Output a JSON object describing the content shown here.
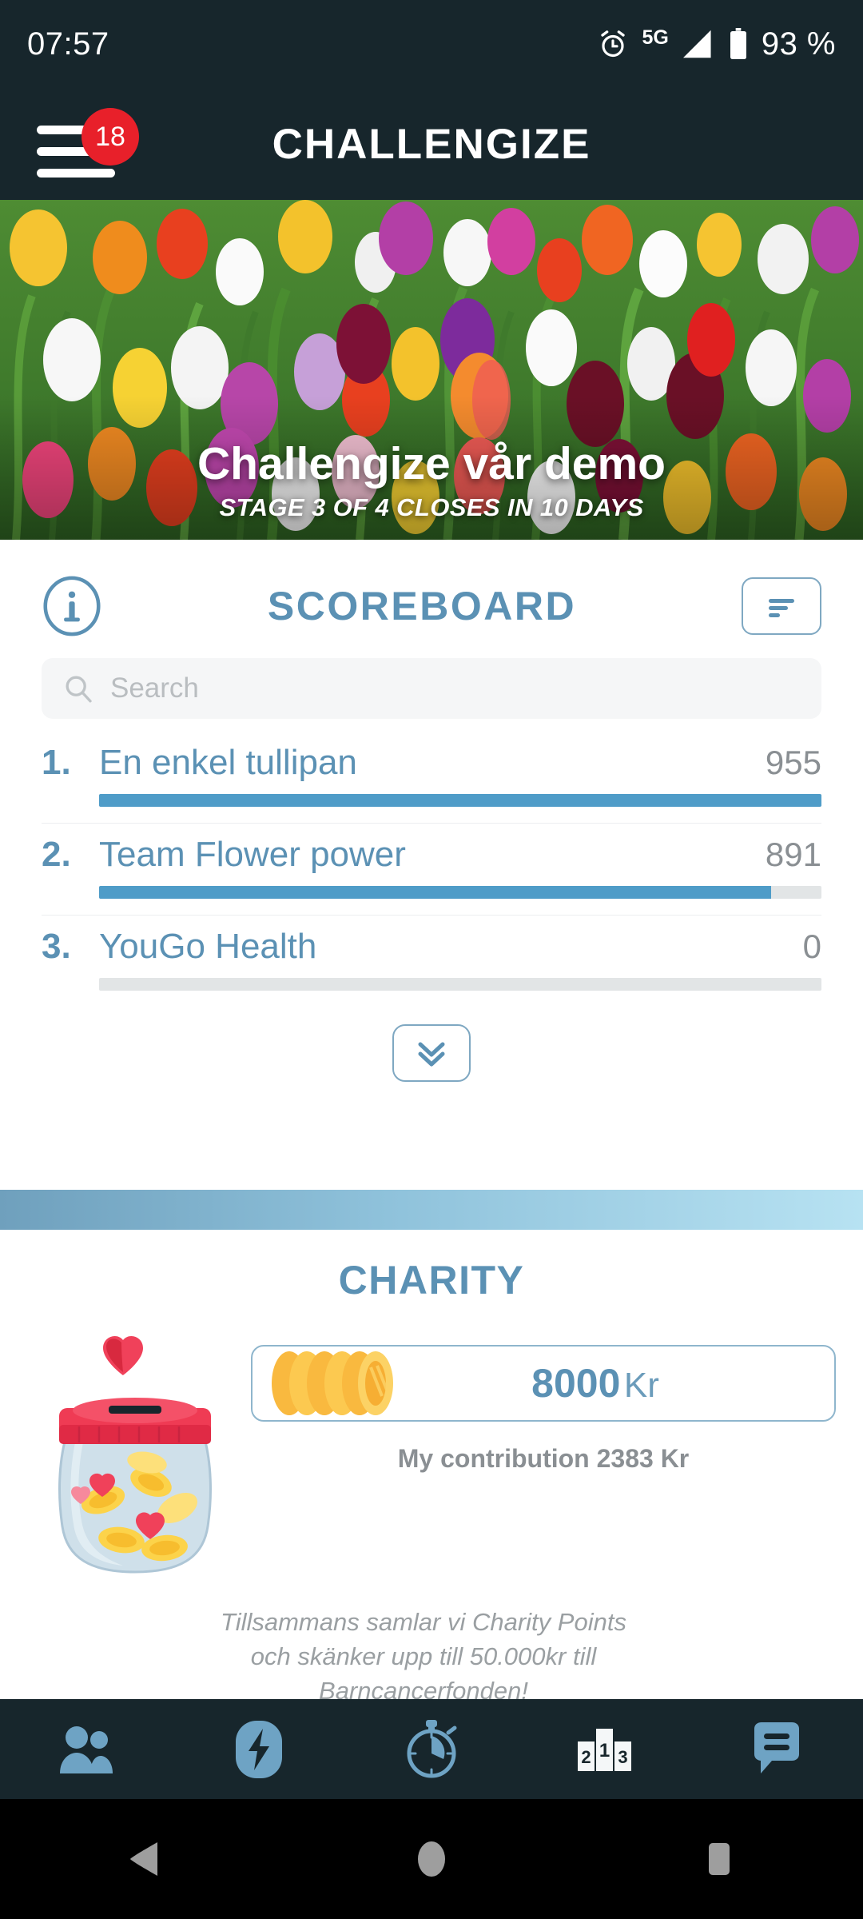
{
  "status_bar": {
    "time": "07:57",
    "network": "5G",
    "battery_pct": "93 %",
    "icons": [
      "alarm-icon",
      "signal-icon",
      "battery-icon"
    ]
  },
  "header": {
    "title": "CHALLENGIZE",
    "menu_badge_count": "18",
    "menu_icon": "hamburger-menu-icon"
  },
  "hero": {
    "title": "Challengize vår demo",
    "subtitle": "STAGE 3 OF 4 CLOSES IN 10 DAYS"
  },
  "scoreboard": {
    "title": "SCOREBOARD",
    "info_icon": "info-icon",
    "sort_icon": "sort-icon",
    "search": {
      "value": "",
      "placeholder": "Search"
    },
    "expand_icon": "double-chevron-down-icon",
    "rows": [
      {
        "rank": "1.",
        "name": "En enkel tullipan",
        "score": "955",
        "pct": 100
      },
      {
        "rank": "2.",
        "name": "Team Flower power",
        "score": "891",
        "pct": 93
      },
      {
        "rank": "3.",
        "name": "YouGo Health",
        "score": "0",
        "pct": 0
      }
    ]
  },
  "charity": {
    "title": "CHARITY",
    "jar_icon": "donation-jar-icon",
    "coins_icon": "coin-stack-icon",
    "amount": "8000",
    "currency": "Kr",
    "contribution": "My contribution 2383 Kr",
    "blurb_line1": "Tillsammans samlar vi Charity Points",
    "blurb_line2": "och skänker upp till 50.000kr till",
    "blurb_line3": "Barncancerfonden!"
  },
  "bottom_nav": {
    "items": [
      {
        "name": "nav-team",
        "icon": "people-icon"
      },
      {
        "name": "nav-activity",
        "icon": "lightning-bolt-icon"
      },
      {
        "name": "nav-timer",
        "icon": "stopwatch-icon"
      },
      {
        "name": "nav-ranking",
        "icon": "podium-icon"
      },
      {
        "name": "nav-chat",
        "icon": "chat-bubble-icon"
      }
    ]
  },
  "android_nav": {
    "back": "back-triangle-icon",
    "home": "home-circle-icon",
    "recents": "recents-square-icon"
  },
  "colors": {
    "header_bg": "#17262c",
    "accent_blue": "#5b91b4",
    "bar_fill": "#4f9cc8",
    "badge_red": "#e8202a"
  }
}
